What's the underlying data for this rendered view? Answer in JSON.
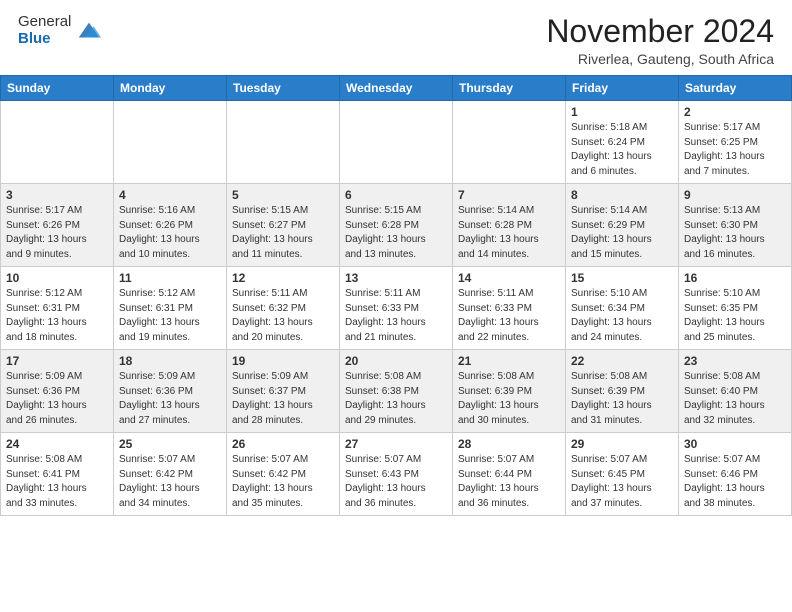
{
  "header": {
    "logo_general": "General",
    "logo_blue": "Blue",
    "month_title": "November 2024",
    "location": "Riverlea, Gauteng, South Africa"
  },
  "days_of_week": [
    "Sunday",
    "Monday",
    "Tuesday",
    "Wednesday",
    "Thursday",
    "Friday",
    "Saturday"
  ],
  "weeks": [
    [
      {
        "day": "",
        "info": ""
      },
      {
        "day": "",
        "info": ""
      },
      {
        "day": "",
        "info": ""
      },
      {
        "day": "",
        "info": ""
      },
      {
        "day": "",
        "info": ""
      },
      {
        "day": "1",
        "info": "Sunrise: 5:18 AM\nSunset: 6:24 PM\nDaylight: 13 hours\nand 6 minutes."
      },
      {
        "day": "2",
        "info": "Sunrise: 5:17 AM\nSunset: 6:25 PM\nDaylight: 13 hours\nand 7 minutes."
      }
    ],
    [
      {
        "day": "3",
        "info": "Sunrise: 5:17 AM\nSunset: 6:26 PM\nDaylight: 13 hours\nand 9 minutes."
      },
      {
        "day": "4",
        "info": "Sunrise: 5:16 AM\nSunset: 6:26 PM\nDaylight: 13 hours\nand 10 minutes."
      },
      {
        "day": "5",
        "info": "Sunrise: 5:15 AM\nSunset: 6:27 PM\nDaylight: 13 hours\nand 11 minutes."
      },
      {
        "day": "6",
        "info": "Sunrise: 5:15 AM\nSunset: 6:28 PM\nDaylight: 13 hours\nand 13 minutes."
      },
      {
        "day": "7",
        "info": "Sunrise: 5:14 AM\nSunset: 6:28 PM\nDaylight: 13 hours\nand 14 minutes."
      },
      {
        "day": "8",
        "info": "Sunrise: 5:14 AM\nSunset: 6:29 PM\nDaylight: 13 hours\nand 15 minutes."
      },
      {
        "day": "9",
        "info": "Sunrise: 5:13 AM\nSunset: 6:30 PM\nDaylight: 13 hours\nand 16 minutes."
      }
    ],
    [
      {
        "day": "10",
        "info": "Sunrise: 5:12 AM\nSunset: 6:31 PM\nDaylight: 13 hours\nand 18 minutes."
      },
      {
        "day": "11",
        "info": "Sunrise: 5:12 AM\nSunset: 6:31 PM\nDaylight: 13 hours\nand 19 minutes."
      },
      {
        "day": "12",
        "info": "Sunrise: 5:11 AM\nSunset: 6:32 PM\nDaylight: 13 hours\nand 20 minutes."
      },
      {
        "day": "13",
        "info": "Sunrise: 5:11 AM\nSunset: 6:33 PM\nDaylight: 13 hours\nand 21 minutes."
      },
      {
        "day": "14",
        "info": "Sunrise: 5:11 AM\nSunset: 6:33 PM\nDaylight: 13 hours\nand 22 minutes."
      },
      {
        "day": "15",
        "info": "Sunrise: 5:10 AM\nSunset: 6:34 PM\nDaylight: 13 hours\nand 24 minutes."
      },
      {
        "day": "16",
        "info": "Sunrise: 5:10 AM\nSunset: 6:35 PM\nDaylight: 13 hours\nand 25 minutes."
      }
    ],
    [
      {
        "day": "17",
        "info": "Sunrise: 5:09 AM\nSunset: 6:36 PM\nDaylight: 13 hours\nand 26 minutes."
      },
      {
        "day": "18",
        "info": "Sunrise: 5:09 AM\nSunset: 6:36 PM\nDaylight: 13 hours\nand 27 minutes."
      },
      {
        "day": "19",
        "info": "Sunrise: 5:09 AM\nSunset: 6:37 PM\nDaylight: 13 hours\nand 28 minutes."
      },
      {
        "day": "20",
        "info": "Sunrise: 5:08 AM\nSunset: 6:38 PM\nDaylight: 13 hours\nand 29 minutes."
      },
      {
        "day": "21",
        "info": "Sunrise: 5:08 AM\nSunset: 6:39 PM\nDaylight: 13 hours\nand 30 minutes."
      },
      {
        "day": "22",
        "info": "Sunrise: 5:08 AM\nSunset: 6:39 PM\nDaylight: 13 hours\nand 31 minutes."
      },
      {
        "day": "23",
        "info": "Sunrise: 5:08 AM\nSunset: 6:40 PM\nDaylight: 13 hours\nand 32 minutes."
      }
    ],
    [
      {
        "day": "24",
        "info": "Sunrise: 5:08 AM\nSunset: 6:41 PM\nDaylight: 13 hours\nand 33 minutes."
      },
      {
        "day": "25",
        "info": "Sunrise: 5:07 AM\nSunset: 6:42 PM\nDaylight: 13 hours\nand 34 minutes."
      },
      {
        "day": "26",
        "info": "Sunrise: 5:07 AM\nSunset: 6:42 PM\nDaylight: 13 hours\nand 35 minutes."
      },
      {
        "day": "27",
        "info": "Sunrise: 5:07 AM\nSunset: 6:43 PM\nDaylight: 13 hours\nand 36 minutes."
      },
      {
        "day": "28",
        "info": "Sunrise: 5:07 AM\nSunset: 6:44 PM\nDaylight: 13 hours\nand 36 minutes."
      },
      {
        "day": "29",
        "info": "Sunrise: 5:07 AM\nSunset: 6:45 PM\nDaylight: 13 hours\nand 37 minutes."
      },
      {
        "day": "30",
        "info": "Sunrise: 5:07 AM\nSunset: 6:46 PM\nDaylight: 13 hours\nand 38 minutes."
      }
    ]
  ]
}
